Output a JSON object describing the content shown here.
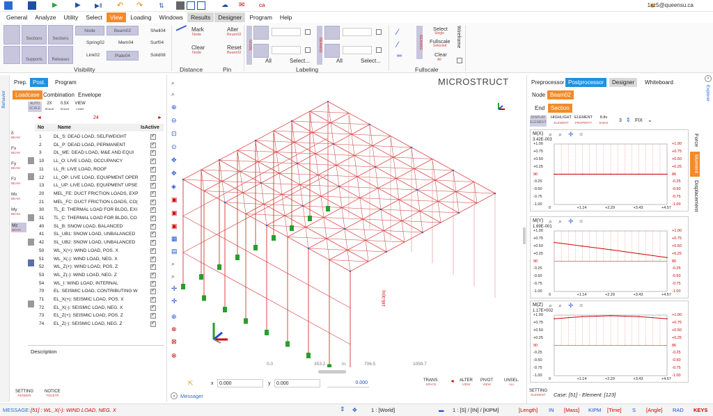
{
  "user": {
    "email": "1xz5@queensu.ca"
  },
  "menu": [
    "General",
    "Analyze",
    "Utility",
    "Select",
    "View",
    "Loading",
    "Windows",
    "Results",
    "Designer",
    "Program",
    "Help"
  ],
  "ribbon": {
    "visibility_label": "Visibility",
    "vis_buttons": [
      "Sections",
      "Sections",
      "Supports",
      "Releases",
      "Node",
      "Beam02",
      "Link02",
      "Mem04",
      "Plate04"
    ],
    "vis_small": [
      "Shell04",
      "Spring02",
      "Surf04",
      "Solid08"
    ],
    "mark": "Mark",
    "mark_sub": "Node",
    "clear": "Clear",
    "clear_sub": "Node",
    "alter": "Alter",
    "alter_sub": "Beam02",
    "reset": "Reset",
    "reset_sub": "Beam02",
    "distance": "Distance",
    "pin": "Pin",
    "labeling_label": "Labeling",
    "lab_node": "NODE",
    "lab_beam": "BEAM02",
    "all1": "All",
    "select1": "Select...",
    "all2": "All",
    "select2": "Select...",
    "fs_beam": "BEAM02",
    "fs_select": "Select",
    "fs_select_sub": "Single",
    "fs_full": "Fullscale",
    "fs_full_sub": "Selected",
    "fs_clear": "Clear",
    "fs_clear_sub": "All",
    "fullscale_label": "Fullscale",
    "wireframe": "Wireframe"
  },
  "left": {
    "vert_beh": "Behavior",
    "tabs": [
      "Prep.",
      "Post.",
      "Program"
    ],
    "subtabs": [
      "Loadcase",
      "Combination",
      "Envelope"
    ],
    "scale": [
      "AUTO",
      "2X",
      "0.5X",
      "VIEW"
    ],
    "scale_sub": [
      "SCALE",
      "SCALE",
      "SCALE",
      "LOAD"
    ],
    "count": "24",
    "side": [
      {
        "k": "δ",
        "s": "BEAM"
      },
      {
        "k": "Fx",
        "s": "BEAM"
      },
      {
        "k": "Fy",
        "s": "BEAM"
      },
      {
        "k": "Fz",
        "s": "BEAM"
      },
      {
        "k": "Mx",
        "s": "BEAM"
      },
      {
        "k": "My",
        "s": "BEAM"
      },
      {
        "k": "Mz",
        "s": "BEAM"
      }
    ],
    "cols": {
      "no": "No",
      "name": "Name",
      "active": "IsActive"
    },
    "rows": [
      {
        "no": "1",
        "name": "DL_S: DEAD LOAD, SELFWEIGHT"
      },
      {
        "no": "2",
        "name": "DL_P: DEAD LOAD, PERMANENT"
      },
      {
        "no": "3",
        "name": "DL_ME: DEAD LOAD, M&E AND EQUI"
      },
      {
        "no": "10",
        "name": "LL_O: LIVE LOAD, OCCUPANCY"
      },
      {
        "no": "11",
        "name": "LL_R: LIVE LOAD, ROOF"
      },
      {
        "no": "12",
        "name": "LL_OP: LIVE LOAD, EQUIPMENT OPER"
      },
      {
        "no": "13",
        "name": "LL_UP: LIVE LOAD, EQUIPMENT UPSE"
      },
      {
        "no": "20",
        "name": "MEL_FE: DUCT FRICTION LOADS, EXP"
      },
      {
        "no": "21",
        "name": "MEL_FC: DUCT FRICTION LOADS, CO("
      },
      {
        "no": "30",
        "name": "TL_E: THERMAL LOAD FOR BLDG, EXI"
      },
      {
        "no": "31",
        "name": "TL_C: THERMAL LOAD FOR BLDG, CO"
      },
      {
        "no": "40",
        "name": "SL_B: SNOW LOAD, BALANCED"
      },
      {
        "no": "41",
        "name": "SL_UB1: SNOW LOAD, UNBALANCED"
      },
      {
        "no": "42",
        "name": "SL_UB2: SNOW LOAD, UNBALANCED"
      },
      {
        "no": "50",
        "name": "WL_X(+): WIND LOAD, POS. X"
      },
      {
        "no": "51",
        "name": "WL_X(-): WIND LOAD, NEG. X"
      },
      {
        "no": "52",
        "name": "WL_Z(+): WIND LOAD, POS. Z"
      },
      {
        "no": "53",
        "name": "WL_Z(-): WIND LOAD, NEG. Z"
      },
      {
        "no": "54",
        "name": "WL_I: WIND LOAD, INTERNAL"
      },
      {
        "no": "70",
        "name": "EL: SEISMIC LOAD, CONTRIBUTING W"
      },
      {
        "no": "71",
        "name": "EL_X(+): SEISMIC LOAD, POS. X"
      },
      {
        "no": "72",
        "name": "EL_X(-): SEISMIC LOAD, NEG. X"
      },
      {
        "no": "73",
        "name": "EL_Z(+): SEISMIC LOAD, POS. Z"
      },
      {
        "no": "74",
        "name": "EL_Z(-): SEISMIC LOAD, NEG. Z"
      }
    ],
    "description": "Description",
    "setting": "SETTING",
    "setting_sub": "RENDER",
    "notice": "NOTICE",
    "notice_sub": "TOGETR"
  },
  "viewport": {
    "brand": "MICROSTRUCT",
    "ruler": [
      "0.0",
      "353.2",
      "in",
      "706.5",
      "1059.7"
    ],
    "x_label": "x",
    "x_val": "0.000",
    "y_label": "y",
    "y_val": "0.000",
    "z_val": "0.000",
    "trans": "TRANS.",
    "trans_sub": "SPACE",
    "alter": "ALTER",
    "alter_sub": "VIEW",
    "pivot": "PIVOT",
    "pivot_sub": "VIEW",
    "unsel": "UNSEL.",
    "unsel_sub": "ALL",
    "messager": "Messager",
    "dim_label": "165.0(in)"
  },
  "right": {
    "vert_exp": "Explorer",
    "tabs": [
      "Preprocessor",
      "Postprocessor",
      "Designer",
      "Whiteboard"
    ],
    "sub1": [
      "Node",
      "Beam02"
    ],
    "sub2": [
      "End",
      "Section"
    ],
    "opts": [
      {
        "t": "DISPLAY",
        "s": "ELEMENT"
      },
      {
        "t": "HIGHLIGHT",
        "s": "ELEMENT"
      },
      {
        "t": "ELEMENT",
        "s": "PROPERTY"
      },
      {
        "t": "8.8x",
        "s": "Extent"
      }
    ],
    "fix_n": "3",
    "fix": "FIX",
    "vtabs": [
      "Force",
      "Moment",
      "Displacement"
    ],
    "setting": "SETTING",
    "setting_sub": "ELEMENT",
    "case": "Case: [51] - Element: [123]"
  },
  "chart_data": [
    {
      "type": "line",
      "title": "M(X)",
      "annotation": "3.42E-003",
      "yticks": [
        "+1.00",
        "+0.75",
        "+0.50",
        "+0.25",
        "90",
        "-0.25",
        "-0.50",
        "-0.75",
        "-1.00"
      ],
      "yticks_r": [
        "+1.00",
        "+0.75",
        "+0.50",
        "+0.25",
        "86",
        "-0.25",
        "-0.50",
        "-0.75",
        "-1.00"
      ],
      "xticks": [
        "0",
        "+1.14",
        "+2.29",
        "+3.43",
        "+4.57"
      ],
      "x": [
        0,
        1.14,
        2.29,
        3.43,
        4.57
      ],
      "y": [
        0.003,
        0.003,
        0.003,
        0.003,
        0.003
      ],
      "ylim": [
        -1,
        1
      ]
    },
    {
      "type": "line",
      "title": "M(Y)",
      "annotation": "1.69E-001",
      "yticks": [
        "+1.00",
        "+0.75",
        "+0.50",
        "+0.25",
        "90",
        "-0.25",
        "-0.50",
        "-0.75",
        "-1.00"
      ],
      "yticks_r": [
        "+1.00",
        "+0.75",
        "+0.50",
        "+0.25",
        "86",
        "-0.25",
        "-0.50",
        "-0.75",
        "-1.00"
      ],
      "xticks": [
        "0",
        "+1.14",
        "+2.29",
        "+3.43",
        "+4.57"
      ],
      "x": [
        0,
        1.14,
        2.29,
        3.43,
        4.57
      ],
      "y": [
        0.62,
        0.5,
        0.38,
        0.25,
        0.12
      ],
      "ylim": [
        -1,
        1
      ]
    },
    {
      "type": "line",
      "title": "M(Z)",
      "annotation": "1.17E+002",
      "yticks": [
        "+1.00",
        "+0.75",
        "+0.50",
        "+0.25",
        "90",
        "-0.25",
        "-0.50",
        "-0.75",
        "-1.00"
      ],
      "yticks_r": [
        "+1.00",
        "+0.75",
        "+0.50",
        "+0.25",
        "86",
        "-0.25",
        "-0.50",
        "-0.75",
        "-1.00"
      ],
      "xticks": [
        "0",
        "+1.14",
        "+2.29",
        "+3.43",
        "+4.57"
      ],
      "x": [
        0,
        1.14,
        2.29,
        3.43,
        4.57
      ],
      "y": [
        0.88,
        0.95,
        0.98,
        0.95,
        0.88
      ],
      "ylim": [
        -1,
        1
      ]
    }
  ],
  "status": {
    "message_label": "MESSAGE:",
    "message": "[51] : WL_X(-): WIND LOAD, NEG. X",
    "world": "1 : [World]",
    "units": "1 : [S] / [IN] / [KIPM]",
    "length": "[Length]",
    "in": "IN",
    "mass": "[Mass]",
    "kipm": "KIPM",
    "time": "[Time]",
    "s": "S",
    "angle": "[Angle]",
    "rad": "RAD",
    "keys": "KEYS"
  }
}
